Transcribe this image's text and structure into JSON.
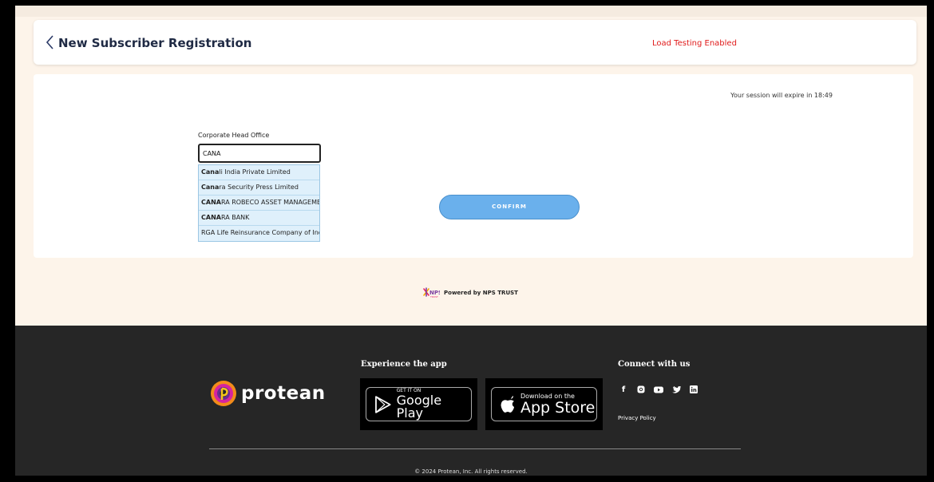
{
  "header": {
    "title": "New Subscriber Registration",
    "load_testing": "Load Testing Enabled"
  },
  "session": {
    "text": "Your session will expire in 18:49"
  },
  "form": {
    "field_label": "Corporate Head Office",
    "input_value": "CANA",
    "suggestions": [
      {
        "match": "Cana",
        "rest": "li India Private Limited"
      },
      {
        "match": "Cana",
        "rest": "ra Security Press Limited"
      },
      {
        "match": "CANA",
        "rest": "RA ROBECO ASSET MANAGEMENT"
      },
      {
        "match": "CANA",
        "rest": "RA BANK"
      },
      {
        "match": "",
        "rest": "RGA Life Reinsurance Company of India"
      }
    ],
    "confirm_label": "CONFIRM"
  },
  "powered": {
    "logo_text": "NPS",
    "logo_sub": "TRUST",
    "text": "Powered by NPS TRUST"
  },
  "footer": {
    "brand": "protean",
    "app_title": "Experience the app",
    "google_play_small": "GET IT ON",
    "google_play_big": "Google Play",
    "app_store_small": "Download on the",
    "app_store_big": "App Store",
    "connect_title": "Connect with us",
    "socials": [
      "facebook-icon",
      "instagram-icon",
      "youtube-icon",
      "twitter-icon",
      "linkedin-icon"
    ],
    "privacy": "Privacy Policy",
    "copyright": "© 2024 Protean, Inc. All rights reserved."
  },
  "colors": {
    "accent": "#6ab0ec",
    "alert": "#e01b1b",
    "footer_bg": "#262626",
    "page_bg": "#fdf4ea"
  }
}
